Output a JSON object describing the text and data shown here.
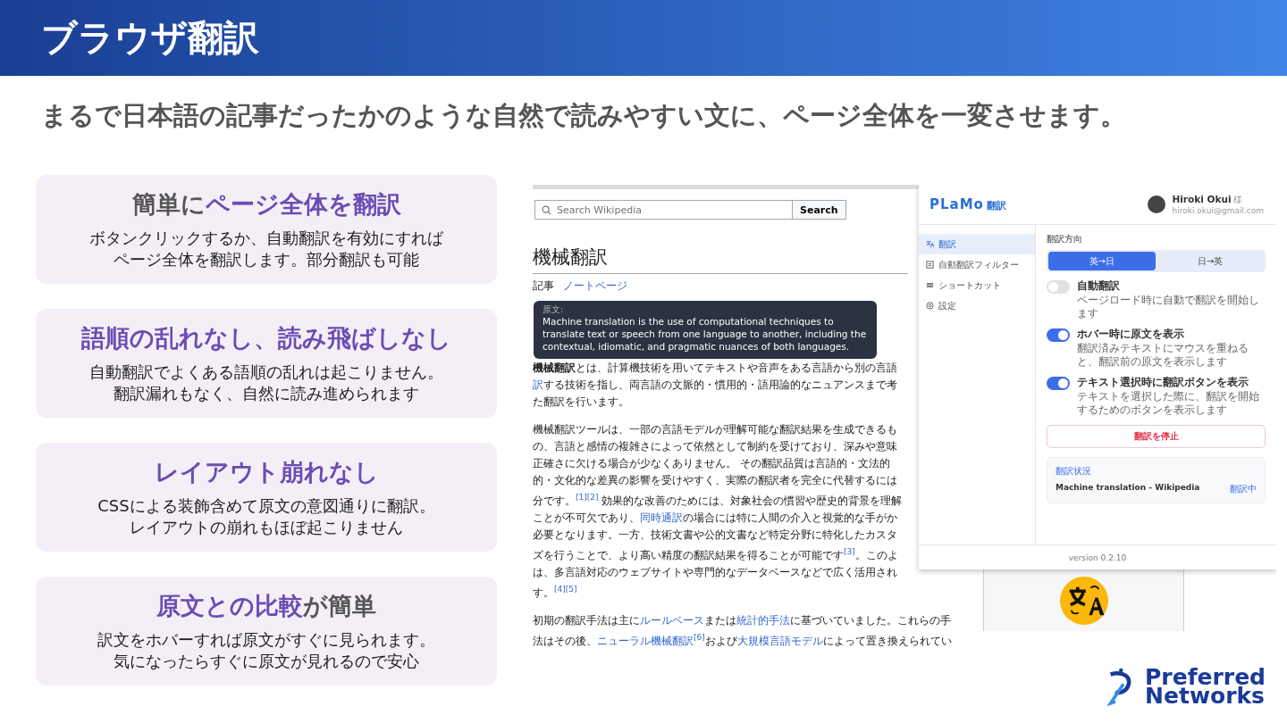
{
  "header": {
    "title": "ブラウザ翻訳"
  },
  "subtitle": "まるで日本語の記事だったかのような自然で読みやすい文に、ページ全体を一変させます。",
  "features": [
    {
      "title": [
        {
          "t": "簡単に",
          "accent": false
        },
        {
          "t": "ページ全体を翻訳",
          "accent": true
        }
      ],
      "body": [
        "ボタンクリックするか、自動翻訳を有効にすれば",
        "ページ全体を翻訳します。部分翻訳も可能"
      ]
    },
    {
      "title": [
        {
          "t": "語順の乱れなし、読み飛ばしなし",
          "accent": true
        }
      ],
      "body": [
        "自動翻訳でよくある語順の乱れは起こりません。",
        "翻訳漏れもなく、自然に読み進められます"
      ]
    },
    {
      "title": [
        {
          "t": "レイアウト崩れなし",
          "accent": true
        }
      ],
      "body": [
        "CSSによる装飾含めて原文の意図通りに翻訳。",
        "レイアウトの崩れもほぼ起こりません"
      ]
    },
    {
      "title": [
        {
          "t": "原文との比較",
          "accent": true
        },
        {
          "t": "が簡単",
          "accent": false
        }
      ],
      "body": [
        "訳文をホバーすれば原文がすぐに見られます。",
        "気になったらすぐに原文が見れるので安心"
      ]
    }
  ],
  "wiki": {
    "search_placeholder": "Search Wikipedia",
    "search_button": "Search",
    "heading": "機械翻訳",
    "tabs": [
      {
        "label": "記事",
        "selected": true
      },
      {
        "label": "ノートページ",
        "selected": false
      }
    ],
    "paragraphs": [
      [
        [
          {
            "kind": "bold",
            "t": "機械翻訳"
          },
          {
            "kind": "text",
            "t": "とは、計算機技術を用いてテキストや音声をある言語から別の言語"
          }
        ],
        [
          {
            "kind": "link",
            "t": "訳"
          },
          {
            "kind": "text",
            "t": "する技術を指し、両言語の文脈的・慣用的・語用論的なニュアンスまで考"
          }
        ],
        [
          {
            "kind": "text",
            "t": "た翻訳を行います。"
          }
        ]
      ],
      [
        [
          {
            "kind": "text",
            "t": "機械翻訳ツールは、一部の言語モデルが理解可能な翻訳結果を生成できるも"
          }
        ],
        [
          {
            "kind": "text",
            "t": "の、言語と感情の複雑さによって依然として制約を受けており、深みや意味"
          }
        ],
        [
          {
            "kind": "text",
            "t": "正確さに欠ける場合が少なくありません。 その翻訳品質は言語的・文法的"
          }
        ],
        [
          {
            "kind": "text",
            "t": "的・文化的な差異の影響を受けやすく、実際の翻訳者を完全に代替するには"
          }
        ],
        [
          {
            "kind": "text",
            "t": "分です。"
          },
          {
            "kind": "ref",
            "t": "[1][2]"
          },
          {
            "kind": "text",
            "t": " 効果的な改善のためには、対象社会の慣習や歴史的背景を理解"
          }
        ],
        [
          {
            "kind": "text",
            "t": "ことが不可欠であり、"
          },
          {
            "kind": "link",
            "t": "同時通訳"
          },
          {
            "kind": "text",
            "t": "の場合には特に人間の介入と視覚的な手がか"
          }
        ],
        [
          {
            "kind": "text",
            "t": "必要となります。一方、技術文書や公的文書など特定分野に特化したカスタ"
          }
        ],
        [
          {
            "kind": "text",
            "t": "ズを行うことで、より高い精度の翻訳結果を得ることが可能です"
          },
          {
            "kind": "ref",
            "t": "[3]"
          },
          {
            "kind": "text",
            "t": "。このよ"
          }
        ],
        [
          {
            "kind": "text",
            "t": "は、多言語対応のウェブサイトや専門的なデータベースなどで広く活用され"
          }
        ],
        [
          {
            "kind": "text",
            "t": "す。"
          },
          {
            "kind": "ref",
            "t": "[4][5]"
          }
        ]
      ],
      [
        [
          {
            "kind": "text",
            "t": "初期の翻訳手法は主に"
          },
          {
            "kind": "link",
            "t": "ルールベース"
          },
          {
            "kind": "text",
            "t": "または"
          },
          {
            "kind": "link",
            "t": "統計的手法"
          },
          {
            "kind": "text",
            "t": "に基づいていました。これらの手"
          }
        ],
        [
          {
            "kind": "text",
            "t": "法はその後、"
          },
          {
            "kind": "link",
            "t": "ニューラル機械翻訳"
          },
          {
            "kind": "ref",
            "t": "[6]"
          },
          {
            "kind": "text",
            "t": "および"
          },
          {
            "kind": "link",
            "t": "大規模言語モデル"
          },
          {
            "kind": "text",
            "t": "によって置き換えられてい"
          }
        ]
      ]
    ],
    "tooltip": {
      "label": "原文:",
      "text": "Machine translation is the use of computational techniques to translate text or speech from one language to another, including the contextual, idiomatic, and pragmatic nuances of both languages."
    }
  },
  "panel": {
    "logo": "PLaMo",
    "logo_suffix": "翻訳",
    "user": {
      "name": "Hiroki Okui",
      "honorific": "様",
      "email": "hiroki.okui@gmail.com"
    },
    "sidebar": [
      {
        "label": "翻訳",
        "selected": true
      },
      {
        "label": "自動翻訳フィルター",
        "selected": false
      },
      {
        "label": "ショートカット",
        "selected": false
      },
      {
        "label": "設定",
        "selected": false
      }
    ],
    "direction_label": "翻訳方向",
    "directions": [
      {
        "label": "英→日",
        "selected": true
      },
      {
        "label": "日→英",
        "selected": false
      }
    ],
    "toggles": [
      {
        "label": "自動翻訳",
        "description": "ページロード時に自動で翻訳を開始します",
        "on": false
      },
      {
        "label": "ホバー時に原文を表示",
        "description": "翻訳済みテキストにマウスを重ねると、翻訳前の原文を表示します",
        "on": true
      },
      {
        "label": "テキスト選択時に翻訳ボタンを表示",
        "description": "テキストを選択した際に、翻訳を開始するためのボタンを表示します",
        "on": true
      }
    ],
    "stop_button": "翻訳を停止",
    "status": {
      "title": "翻訳状況",
      "page": "Machine translation - Wikipedia",
      "state": "翻訳中"
    },
    "version": "version 0.2.10"
  },
  "brand": [
    "Preferred",
    "Networks"
  ]
}
